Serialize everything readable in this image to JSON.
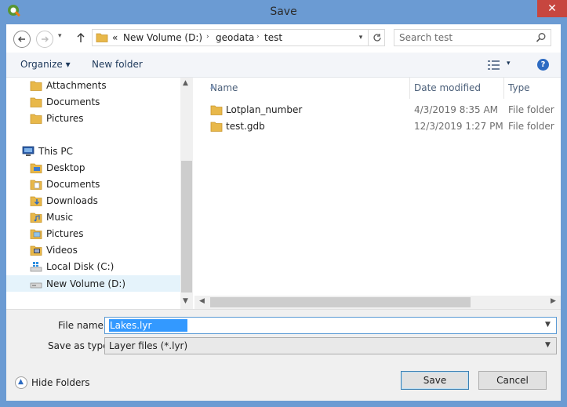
{
  "window": {
    "title": "Save",
    "close_glyph": "✕"
  },
  "navigation": {
    "back_icon": "back-arrow-icon",
    "forward_icon": "forward-arrow-icon",
    "recent_dropdown_glyph": "▾",
    "up_icon": "up-arrow-icon"
  },
  "address": {
    "overflow": "«",
    "crumbs": [
      "New Volume (D:)",
      "geodata",
      "test"
    ],
    "separator": "›"
  },
  "search": {
    "placeholder": "Search test"
  },
  "toolbar": {
    "organize_label": "Organize ▾",
    "new_folder_label": "New folder",
    "view_dropdown_glyph": "▾",
    "help_glyph": "?"
  },
  "nav_pane": {
    "items": [
      {
        "label": "Attachments",
        "icon": "folder-icon"
      },
      {
        "label": "Documents",
        "icon": "folder-icon"
      },
      {
        "label": "Pictures",
        "icon": "folder-icon"
      },
      {
        "label": "This PC",
        "icon": "computer-icon"
      },
      {
        "label": "Desktop",
        "icon": "desktop-folder-icon"
      },
      {
        "label": "Documents",
        "icon": "documents-folder-icon"
      },
      {
        "label": "Downloads",
        "icon": "downloads-folder-icon"
      },
      {
        "label": "Music",
        "icon": "music-folder-icon"
      },
      {
        "label": "Pictures",
        "icon": "pictures-folder-icon"
      },
      {
        "label": "Videos",
        "icon": "videos-folder-icon"
      },
      {
        "label": "Local Disk (C:)",
        "icon": "windows-drive-icon"
      },
      {
        "label": "New Volume (D:)",
        "icon": "drive-icon",
        "selected": true
      }
    ]
  },
  "file_list": {
    "columns": {
      "name": "Name",
      "date": "Date modified",
      "type": "Type"
    },
    "rows": [
      {
        "name": "Lotplan_number",
        "date": "4/3/2019 8:35 AM",
        "type": "File folder"
      },
      {
        "name": "test.gdb",
        "date": "12/3/2019 1:27 PM",
        "type": "File folder"
      }
    ]
  },
  "form": {
    "file_name_label": "File name:",
    "file_name_value": "Lakes.lyr",
    "save_as_type_label": "Save as type:",
    "save_as_type_value": "Layer files (*.lyr)"
  },
  "footer": {
    "hide_folders_label": "Hide Folders",
    "save_label": "Save",
    "cancel_label": "Cancel"
  },
  "colors": {
    "window_frame": "#6b9bd3",
    "close_button": "#c7463f",
    "selection": "#e5f3fb",
    "folder": "#e8b84a",
    "text_highlight": "#3399ff"
  }
}
